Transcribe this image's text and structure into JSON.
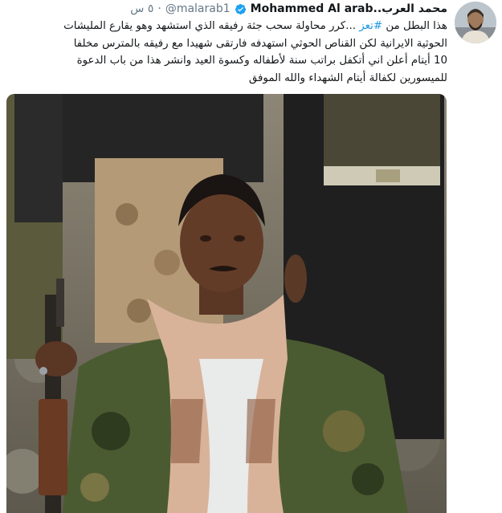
{
  "tweet": {
    "display_name": "محمد العرب..Mohammed Al arab",
    "handle": "@malarab1",
    "separator": "·",
    "time": "٥ س",
    "line1_before": "هذا البطل من ",
    "hashtag": "#تعز",
    "line1_after": "  ...كرر محاولة سحب جثة رفيقه الذي استشهد وهو يقارع المليشات",
    "line2": "الحوثية الايرانية لكن القناص الحوثي استهدفه فارتقى شهيدا مع رفيقه بالمترس مخلفا",
    "line3": "10 أيتام أعلن اني أتكفل براتب سنة لأطفاله وكسوة العيد وانشر هذا من باب الدعوة",
    "line4": "للميسورين لكفالة أيتام الشهداء والله الموفق"
  },
  "colors": {
    "link": "#1b95e0",
    "verified": "#1da1f2",
    "secondary_text": "#657786",
    "primary_text": "#14171a"
  },
  "icons": {
    "verified": "verified-badge-icon"
  }
}
